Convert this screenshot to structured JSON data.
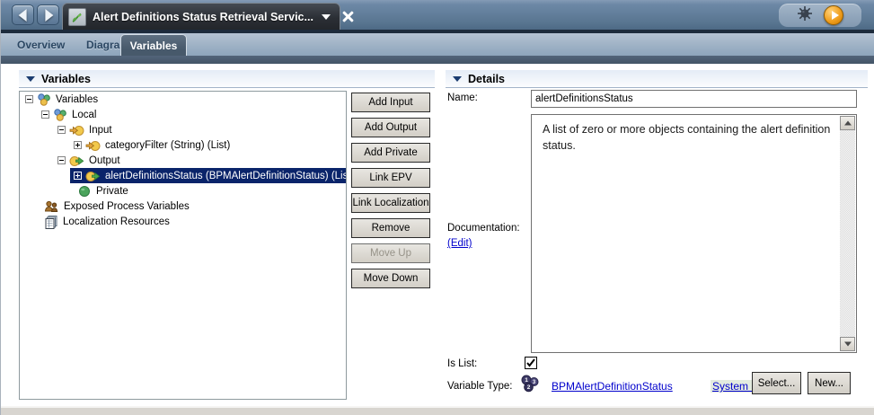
{
  "window": {
    "title": "Alert Definitions Status Retrieval Servic..."
  },
  "tabs": [
    {
      "label": "Overview",
      "active": false
    },
    {
      "label": "Diagram",
      "active": false
    },
    {
      "label": "Variables",
      "active": true
    }
  ],
  "variables_panel": {
    "header": "Variables",
    "tree": [
      {
        "label": "Variables",
        "icon": "variables-cluster-icon",
        "state": "expanded",
        "selected": false
      },
      {
        "label": "Local",
        "icon": "variables-cluster-icon",
        "state": "expanded",
        "selected": false
      },
      {
        "label": "Input",
        "icon": "input-arrow-icon",
        "state": "expanded",
        "selected": false
      },
      {
        "label": "categoryFilter (String) (List)",
        "icon": "input-arrow-icon",
        "state": "collapsed",
        "selected": false
      },
      {
        "label": "Output",
        "icon": "output-arrow-icon",
        "state": "expanded",
        "selected": false
      },
      {
        "label": "alertDefinitionsStatus (BPMAlertDefinitionStatus) (List)",
        "icon": "output-arrow-icon",
        "state": "collapsed",
        "selected": true
      },
      {
        "label": "Private",
        "icon": "private-sphere-icon",
        "state": "leaf",
        "selected": false
      },
      {
        "label": "Exposed Process Variables",
        "icon": "exposed-people-icon",
        "state": "leaf",
        "selected": false
      },
      {
        "label": "Localization Resources",
        "icon": "localization-docs-icon",
        "state": "leaf",
        "selected": false
      }
    ],
    "buttons": [
      {
        "label": "Add Input",
        "enabled": true
      },
      {
        "label": "Add Output",
        "enabled": true
      },
      {
        "label": "Add Private",
        "enabled": true
      },
      {
        "label": "Link EPV",
        "enabled": true
      },
      {
        "label": "Link Localization",
        "enabled": true
      },
      {
        "label": "Remove",
        "enabled": true
      },
      {
        "label": "Move Up",
        "enabled": false
      },
      {
        "label": "Move Down",
        "enabled": true
      }
    ]
  },
  "details_panel": {
    "header": "Details",
    "name_label": "Name:",
    "name_value": "alertDefinitionsStatus",
    "documentation_label": "Documentation:",
    "edit_link": "(Edit)",
    "documentation_text": "A list of zero or more objects containing the alert definition status.",
    "is_list_label": "Is List:",
    "is_list_checked": true,
    "variable_type_label": "Variable Type:",
    "variable_type_value": "BPMAlertDefinitionStatus",
    "system_data_link": "System Data",
    "select_button": "Select...",
    "new_button": "New..."
  },
  "colors": {
    "selection": "#0a246a",
    "topbar": "#57748f",
    "active_tab": "#47596b",
    "link": "#0000cc",
    "play_orange": "#f09f1f"
  }
}
